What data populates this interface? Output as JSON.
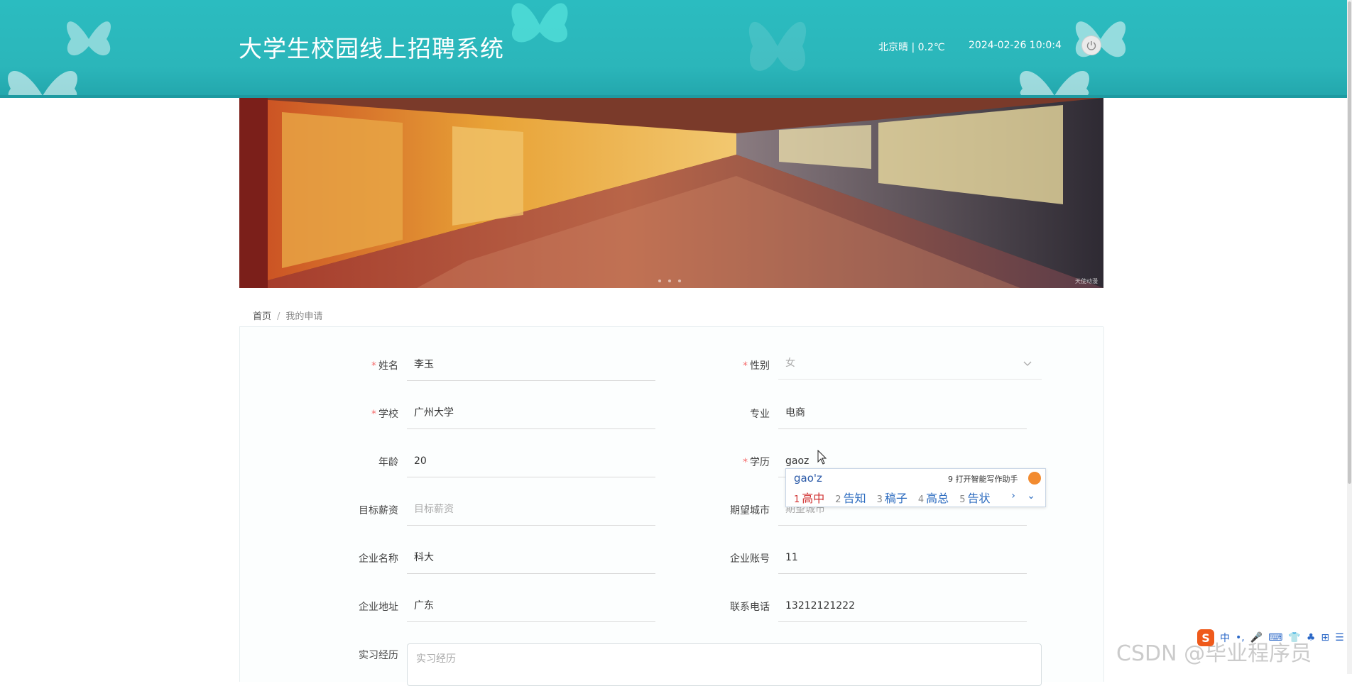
{
  "header": {
    "site_title": "大学生校园线上招聘系统",
    "weather": "北京晴 | 0.2℃",
    "datetime": "2024-02-26   10:0:4",
    "power_icon": "power-icon",
    "theme_colors": {
      "header": "#2bbcc0",
      "accent_border": "#1d9aa1"
    }
  },
  "banner": {
    "watermark": "天使动漫"
  },
  "breadcrumb": {
    "home": "首页",
    "separator": "/",
    "current": "我的申请"
  },
  "form": {
    "name": {
      "label": "姓名",
      "value": "李玉",
      "required": true
    },
    "gender": {
      "label": "性别",
      "value": "女",
      "required": true
    },
    "school": {
      "label": "学校",
      "value": "广州大学",
      "required": true
    },
    "major": {
      "label": "专业",
      "value": "电商",
      "required": false
    },
    "age": {
      "label": "年龄",
      "value": "20",
      "required": false
    },
    "education": {
      "label": "学历",
      "value": "gaoz",
      "required": true
    },
    "salary": {
      "label": "目标薪资",
      "placeholder": "目标薪资"
    },
    "city": {
      "label": "期望城市",
      "placeholder": "期望城市"
    },
    "company_name": {
      "label": "企业名称",
      "value": "科大"
    },
    "company_account": {
      "label": "企业账号",
      "value": "11"
    },
    "company_address": {
      "label": "企业地址",
      "value": "广东"
    },
    "phone": {
      "label": "联系电话",
      "value": "13212121222"
    },
    "internship": {
      "label": "实习经历",
      "placeholder": "实习经历"
    },
    "required_mark": "*"
  },
  "ime": {
    "composition": "gao'z",
    "assistant": "9 打开智能写作助手",
    "candidates": [
      {
        "num": "1",
        "text": "高中"
      },
      {
        "num": "2",
        "text": "告知"
      },
      {
        "num": "3",
        "text": "稿子"
      },
      {
        "num": "4",
        "text": "高总"
      },
      {
        "num": "5",
        "text": "告状"
      }
    ],
    "nav": "› ⌄"
  },
  "ime_toolbar": {
    "logo": "S",
    "items": [
      "中",
      "•,",
      "🎤",
      "⌨",
      "👕",
      "♣",
      "⊞",
      "☰"
    ]
  },
  "watermark": "CSDN @毕业程序员"
}
